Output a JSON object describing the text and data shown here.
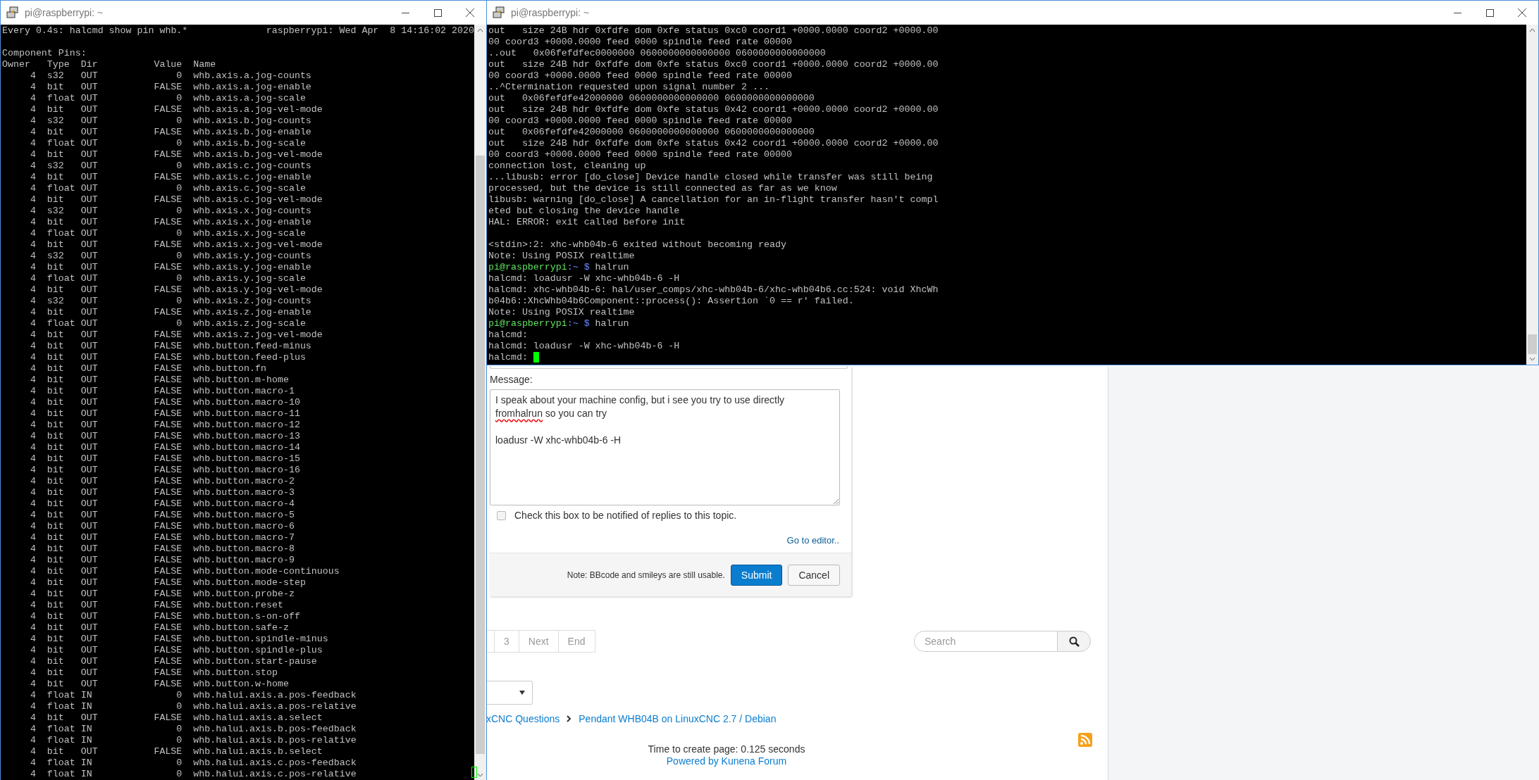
{
  "terminal_left": {
    "title": "pi@raspberrypi: ~",
    "watch_command": "Every 0.4s: halcmd show pin whb.*",
    "watch_status": "raspberrypi: Wed Apr  8 14:16:02 2020",
    "section_title": "Component Pins:",
    "columns": [
      "Owner",
      "Type",
      "Dir",
      "Value",
      "Name"
    ],
    "pins": [
      {
        "owner": "4",
        "type": "s32",
        "dir": "OUT",
        "value": "0",
        "name": "whb.axis.a.jog-counts"
      },
      {
        "owner": "4",
        "type": "bit",
        "dir": "OUT",
        "value": "FALSE",
        "name": "whb.axis.a.jog-enable"
      },
      {
        "owner": "4",
        "type": "float",
        "dir": "OUT",
        "value": "0",
        "name": "whb.axis.a.jog-scale"
      },
      {
        "owner": "4",
        "type": "bit",
        "dir": "OUT",
        "value": "FALSE",
        "name": "whb.axis.a.jog-vel-mode"
      },
      {
        "owner": "4",
        "type": "s32",
        "dir": "OUT",
        "value": "0",
        "name": "whb.axis.b.jog-counts"
      },
      {
        "owner": "4",
        "type": "bit",
        "dir": "OUT",
        "value": "FALSE",
        "name": "whb.axis.b.jog-enable"
      },
      {
        "owner": "4",
        "type": "float",
        "dir": "OUT",
        "value": "0",
        "name": "whb.axis.b.jog-scale"
      },
      {
        "owner": "4",
        "type": "bit",
        "dir": "OUT",
        "value": "FALSE",
        "name": "whb.axis.b.jog-vel-mode"
      },
      {
        "owner": "4",
        "type": "s32",
        "dir": "OUT",
        "value": "0",
        "name": "whb.axis.c.jog-counts"
      },
      {
        "owner": "4",
        "type": "bit",
        "dir": "OUT",
        "value": "FALSE",
        "name": "whb.axis.c.jog-enable"
      },
      {
        "owner": "4",
        "type": "float",
        "dir": "OUT",
        "value": "0",
        "name": "whb.axis.c.jog-scale"
      },
      {
        "owner": "4",
        "type": "bit",
        "dir": "OUT",
        "value": "FALSE",
        "name": "whb.axis.c.jog-vel-mode"
      },
      {
        "owner": "4",
        "type": "s32",
        "dir": "OUT",
        "value": "0",
        "name": "whb.axis.x.jog-counts"
      },
      {
        "owner": "4",
        "type": "bit",
        "dir": "OUT",
        "value": "FALSE",
        "name": "whb.axis.x.jog-enable"
      },
      {
        "owner": "4",
        "type": "float",
        "dir": "OUT",
        "value": "0",
        "name": "whb.axis.x.jog-scale"
      },
      {
        "owner": "4",
        "type": "bit",
        "dir": "OUT",
        "value": "FALSE",
        "name": "whb.axis.x.jog-vel-mode"
      },
      {
        "owner": "4",
        "type": "s32",
        "dir": "OUT",
        "value": "0",
        "name": "whb.axis.y.jog-counts"
      },
      {
        "owner": "4",
        "type": "bit",
        "dir": "OUT",
        "value": "FALSE",
        "name": "whb.axis.y.jog-enable"
      },
      {
        "owner": "4",
        "type": "float",
        "dir": "OUT",
        "value": "0",
        "name": "whb.axis.y.jog-scale"
      },
      {
        "owner": "4",
        "type": "bit",
        "dir": "OUT",
        "value": "FALSE",
        "name": "whb.axis.y.jog-vel-mode"
      },
      {
        "owner": "4",
        "type": "s32",
        "dir": "OUT",
        "value": "0",
        "name": "whb.axis.z.jog-counts"
      },
      {
        "owner": "4",
        "type": "bit",
        "dir": "OUT",
        "value": "FALSE",
        "name": "whb.axis.z.jog-enable"
      },
      {
        "owner": "4",
        "type": "float",
        "dir": "OUT",
        "value": "0",
        "name": "whb.axis.z.jog-scale"
      },
      {
        "owner": "4",
        "type": "bit",
        "dir": "OUT",
        "value": "FALSE",
        "name": "whb.axis.z.jog-vel-mode"
      },
      {
        "owner": "4",
        "type": "bit",
        "dir": "OUT",
        "value": "FALSE",
        "name": "whb.button.feed-minus"
      },
      {
        "owner": "4",
        "type": "bit",
        "dir": "OUT",
        "value": "FALSE",
        "name": "whb.button.feed-plus"
      },
      {
        "owner": "4",
        "type": "bit",
        "dir": "OUT",
        "value": "FALSE",
        "name": "whb.button.fn"
      },
      {
        "owner": "4",
        "type": "bit",
        "dir": "OUT",
        "value": "FALSE",
        "name": "whb.button.m-home"
      },
      {
        "owner": "4",
        "type": "bit",
        "dir": "OUT",
        "value": "FALSE",
        "name": "whb.button.macro-1"
      },
      {
        "owner": "4",
        "type": "bit",
        "dir": "OUT",
        "value": "FALSE",
        "name": "whb.button.macro-10"
      },
      {
        "owner": "4",
        "type": "bit",
        "dir": "OUT",
        "value": "FALSE",
        "name": "whb.button.macro-11"
      },
      {
        "owner": "4",
        "type": "bit",
        "dir": "OUT",
        "value": "FALSE",
        "name": "whb.button.macro-12"
      },
      {
        "owner": "4",
        "type": "bit",
        "dir": "OUT",
        "value": "FALSE",
        "name": "whb.button.macro-13"
      },
      {
        "owner": "4",
        "type": "bit",
        "dir": "OUT",
        "value": "FALSE",
        "name": "whb.button.macro-14"
      },
      {
        "owner": "4",
        "type": "bit",
        "dir": "OUT",
        "value": "FALSE",
        "name": "whb.button.macro-15"
      },
      {
        "owner": "4",
        "type": "bit",
        "dir": "OUT",
        "value": "FALSE",
        "name": "whb.button.macro-16"
      },
      {
        "owner": "4",
        "type": "bit",
        "dir": "OUT",
        "value": "FALSE",
        "name": "whb.button.macro-2"
      },
      {
        "owner": "4",
        "type": "bit",
        "dir": "OUT",
        "value": "FALSE",
        "name": "whb.button.macro-3"
      },
      {
        "owner": "4",
        "type": "bit",
        "dir": "OUT",
        "value": "FALSE",
        "name": "whb.button.macro-4"
      },
      {
        "owner": "4",
        "type": "bit",
        "dir": "OUT",
        "value": "FALSE",
        "name": "whb.button.macro-5"
      },
      {
        "owner": "4",
        "type": "bit",
        "dir": "OUT",
        "value": "FALSE",
        "name": "whb.button.macro-6"
      },
      {
        "owner": "4",
        "type": "bit",
        "dir": "OUT",
        "value": "FALSE",
        "name": "whb.button.macro-7"
      },
      {
        "owner": "4",
        "type": "bit",
        "dir": "OUT",
        "value": "FALSE",
        "name": "whb.button.macro-8"
      },
      {
        "owner": "4",
        "type": "bit",
        "dir": "OUT",
        "value": "FALSE",
        "name": "whb.button.macro-9"
      },
      {
        "owner": "4",
        "type": "bit",
        "dir": "OUT",
        "value": "FALSE",
        "name": "whb.button.mode-continuous"
      },
      {
        "owner": "4",
        "type": "bit",
        "dir": "OUT",
        "value": "FALSE",
        "name": "whb.button.mode-step"
      },
      {
        "owner": "4",
        "type": "bit",
        "dir": "OUT",
        "value": "FALSE",
        "name": "whb.button.probe-z"
      },
      {
        "owner": "4",
        "type": "bit",
        "dir": "OUT",
        "value": "FALSE",
        "name": "whb.button.reset"
      },
      {
        "owner": "4",
        "type": "bit",
        "dir": "OUT",
        "value": "FALSE",
        "name": "whb.button.s-on-off"
      },
      {
        "owner": "4",
        "type": "bit",
        "dir": "OUT",
        "value": "FALSE",
        "name": "whb.button.safe-z"
      },
      {
        "owner": "4",
        "type": "bit",
        "dir": "OUT",
        "value": "FALSE",
        "name": "whb.button.spindle-minus"
      },
      {
        "owner": "4",
        "type": "bit",
        "dir": "OUT",
        "value": "FALSE",
        "name": "whb.button.spindle-plus"
      },
      {
        "owner": "4",
        "type": "bit",
        "dir": "OUT",
        "value": "FALSE",
        "name": "whb.button.start-pause"
      },
      {
        "owner": "4",
        "type": "bit",
        "dir": "OUT",
        "value": "FALSE",
        "name": "whb.button.stop"
      },
      {
        "owner": "4",
        "type": "bit",
        "dir": "OUT",
        "value": "FALSE",
        "name": "whb.button.w-home"
      },
      {
        "owner": "4",
        "type": "float",
        "dir": "IN",
        "value": "0",
        "name": "whb.halui.axis.a.pos-feedback"
      },
      {
        "owner": "4",
        "type": "float",
        "dir": "IN",
        "value": "0",
        "name": "whb.halui.axis.a.pos-relative"
      },
      {
        "owner": "4",
        "type": "bit",
        "dir": "OUT",
        "value": "FALSE",
        "name": "whb.halui.axis.a.select"
      },
      {
        "owner": "4",
        "type": "float",
        "dir": "IN",
        "value": "0",
        "name": "whb.halui.axis.b.pos-feedback"
      },
      {
        "owner": "4",
        "type": "float",
        "dir": "IN",
        "value": "0",
        "name": "whb.halui.axis.b.pos-relative"
      },
      {
        "owner": "4",
        "type": "bit",
        "dir": "OUT",
        "value": "FALSE",
        "name": "whb.halui.axis.b.select"
      },
      {
        "owner": "4",
        "type": "float",
        "dir": "IN",
        "value": "0",
        "name": "whb.halui.axis.c.pos-feedback"
      },
      {
        "owner": "4",
        "type": "float",
        "dir": "IN",
        "value": "0",
        "name": "whb.halui.axis.c.pos-relative"
      }
    ]
  },
  "terminal_right": {
    "title": "pi@raspberrypi: ~",
    "lines": [
      {
        "kind": "output",
        "text": "out   size 24B hdr 0xfdfe dom 0xfe status 0xc0 coord1 +0000.0000 coord2 +0000.00"
      },
      {
        "kind": "output",
        "text": "00 coord3 +0000.0000 feed 0000 spindle feed rate 00000"
      },
      {
        "kind": "output",
        "text": "..out   0x06fefdfec0000000 0600000000000000 0600000000000000"
      },
      {
        "kind": "output",
        "text": "out   size 24B hdr 0xfdfe dom 0xfe status 0xc0 coord1 +0000.0000 coord2 +0000.00"
      },
      {
        "kind": "output",
        "text": "00 coord3 +0000.0000 feed 0000 spindle feed rate 00000"
      },
      {
        "kind": "output",
        "text": "..^Ctermination requested upon signal number 2 ..."
      },
      {
        "kind": "output",
        "text": "out   0x06fefdfe42000000 0600000000000000 0600000000000000"
      },
      {
        "kind": "output",
        "text": "out   size 24B hdr 0xfdfe dom 0xfe status 0x42 coord1 +0000.0000 coord2 +0000.00"
      },
      {
        "kind": "output",
        "text": "00 coord3 +0000.0000 feed 0000 spindle feed rate 00000"
      },
      {
        "kind": "output",
        "text": "out   0x06fefdfe42000000 0600000000000000 0600000000000000"
      },
      {
        "kind": "output",
        "text": "out   size 24B hdr 0xfdfe dom 0xfe status 0x42 coord1 +0000.0000 coord2 +0000.00"
      },
      {
        "kind": "output",
        "text": "00 coord3 +0000.0000 feed 0000 spindle feed rate 00000"
      },
      {
        "kind": "output",
        "text": "connection lost, cleaning up"
      },
      {
        "kind": "output",
        "text": "...libusb: error [do_close] Device handle closed while transfer was still being"
      },
      {
        "kind": "output",
        "text": "processed, but the device is still connected as far as we know"
      },
      {
        "kind": "output",
        "text": "libusb: warning [do_close] A cancellation for an in-flight transfer hasn't compl"
      },
      {
        "kind": "output",
        "text": "eted but closing the device handle"
      },
      {
        "kind": "output",
        "text": "HAL: ERROR: exit called before init"
      },
      {
        "kind": "blank"
      },
      {
        "kind": "output",
        "text": "<stdin>:2: xhc-whb04b-6 exited without becoming ready"
      },
      {
        "kind": "output",
        "text": "Note: Using POSIX realtime"
      },
      {
        "kind": "prompt",
        "user": "pi@raspberrypi",
        "path": ":~ $",
        "command": "halrun"
      },
      {
        "kind": "output",
        "text": "halcmd: loadusr -W xhc-whb04b-6 -H"
      },
      {
        "kind": "output",
        "text": "halcmd: xhc-whb04b-6: hal/user_comps/xhc-whb04b-6/xhc-whb04b6.cc:524: void XhcWh"
      },
      {
        "kind": "output",
        "text": "b04b6::XhcWhb04b6Component::process(): Assertion `0 == r' failed."
      },
      {
        "kind": "output",
        "text": "Note: Using POSIX realtime"
      },
      {
        "kind": "prompt",
        "user": "pi@raspberrypi",
        "path": ":~ $",
        "command": "halrun"
      },
      {
        "kind": "output",
        "text": "halcmd:"
      },
      {
        "kind": "output",
        "text": "halcmd: loadusr -W xhc-whb04b-6 -H"
      },
      {
        "kind": "cursor",
        "text": "halcmd:"
      }
    ]
  },
  "forum": {
    "message_label": "Message:",
    "message_lines": [
      {
        "kind": "text",
        "text": "I speak about your machine config, but i see you try to use directly"
      },
      {
        "kind": "misspelled",
        "word": "fromhalrun",
        "text": " so you can try"
      },
      {
        "kind": "blank"
      },
      {
        "kind": "text",
        "text": "loadusr -W xhc-whb04b-6 -H"
      }
    ],
    "notify": {
      "label": "Check this box to be notified of replies to this topic.",
      "checked": false
    },
    "editor_link": "Go to editor..",
    "footer_note": "Note: BBcode and smileys are still usable.",
    "buttons": [
      {
        "label": "Submit",
        "kind": "primary"
      },
      {
        "label": "Cancel",
        "kind": "default"
      }
    ],
    "pagination": [
      {
        "kind": "partial"
      },
      {
        "kind": "page",
        "label": "3"
      },
      {
        "kind": "page",
        "label": "Next"
      },
      {
        "kind": "page",
        "label": "End"
      }
    ],
    "search": {
      "placeholder": "Search"
    },
    "breadcrumb": [
      "xCNC Questions",
      "Pendant WHB04B on LinuxCNC 2.7 / Debian"
    ],
    "time_text": "Time to create page: 0.125 seconds",
    "powered_by": "Powered by Kunena Forum"
  }
}
